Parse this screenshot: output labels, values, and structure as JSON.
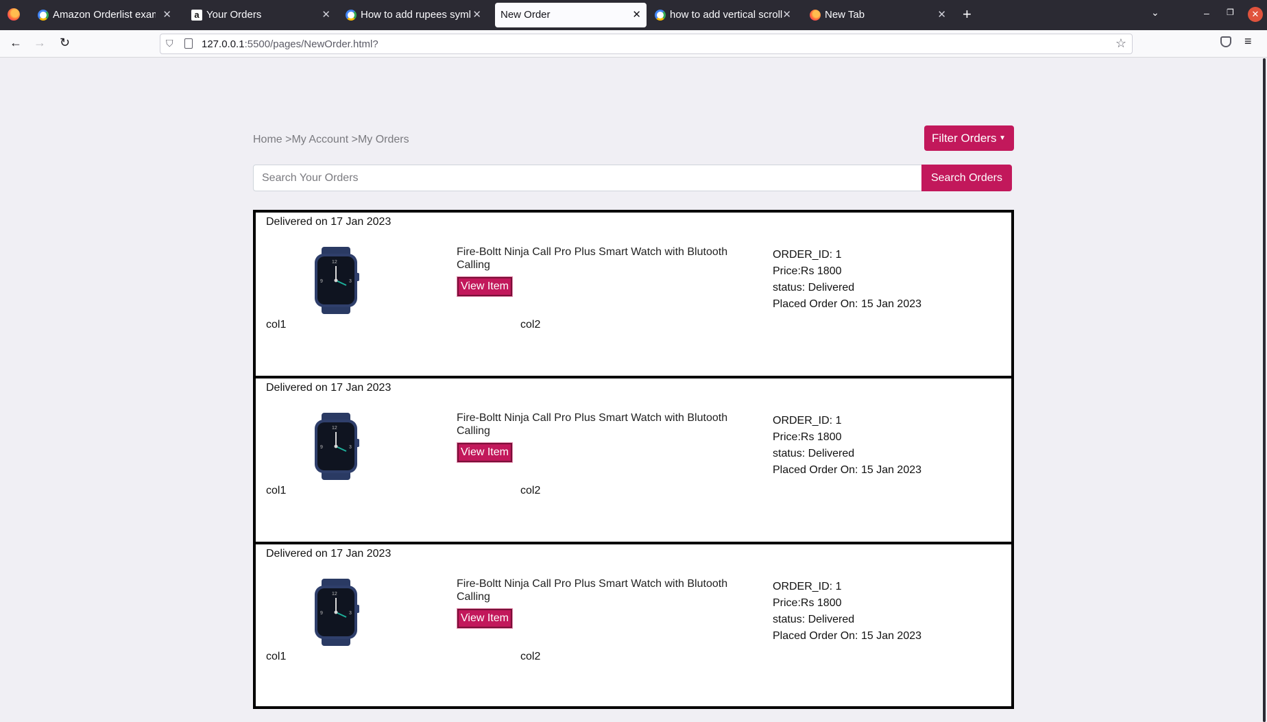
{
  "browser": {
    "tabs": [
      {
        "title": "Amazon Orderlist exampl",
        "favicon": "google-icon"
      },
      {
        "title": "Your Orders",
        "favicon": "amazon-icon"
      },
      {
        "title": "How to add rupees symb",
        "favicon": "google-icon"
      },
      {
        "title": "New Order",
        "favicon": "none"
      },
      {
        "title": "how to add vertical scroll",
        "favicon": "google-icon"
      },
      {
        "title": "New Tab",
        "favicon": "firefox-icon"
      }
    ],
    "url_host": "127.0.0.1",
    "url_rest": ":5500/pages/NewOrder.html?"
  },
  "page": {
    "breadcrumb": "Home >My Account >My Orders",
    "filter_label": "Filter Orders",
    "search_placeholder": "Search Your Orders",
    "search_button": "Search Orders",
    "accent_color": "#c2185b",
    "orders": [
      {
        "delivered": "Delivered on 17 Jan 2023",
        "product": "Fire-Boltt Ninja Call Pro Plus Smart Watch with Blutooth Calling",
        "view_label": "View Item",
        "order_id": "ORDER_ID: 1",
        "price": "Price:Rs 1800",
        "status": "status: Delivered",
        "placed": "Placed Order On: 15 Jan 2023",
        "col1": "col1",
        "col2": "col2"
      },
      {
        "delivered": "Delivered on 17 Jan 2023",
        "product": "Fire-Boltt Ninja Call Pro Plus Smart Watch with Blutooth Calling",
        "view_label": "View Item",
        "order_id": "ORDER_ID: 1",
        "price": "Price:Rs 1800",
        "status": "status: Delivered",
        "placed": "Placed Order On: 15 Jan 2023",
        "col1": "col1",
        "col2": "col2"
      },
      {
        "delivered": "Delivered on 17 Jan 2023",
        "product": "Fire-Boltt Ninja Call Pro Plus Smart Watch with Blutooth Calling",
        "view_label": "View Item",
        "order_id": "ORDER_ID: 1",
        "price": "Price:Rs 1800",
        "status": "status: Delivered",
        "placed": "Placed Order On: 15 Jan 2023",
        "col1": "col1",
        "col2": "col2"
      }
    ]
  }
}
